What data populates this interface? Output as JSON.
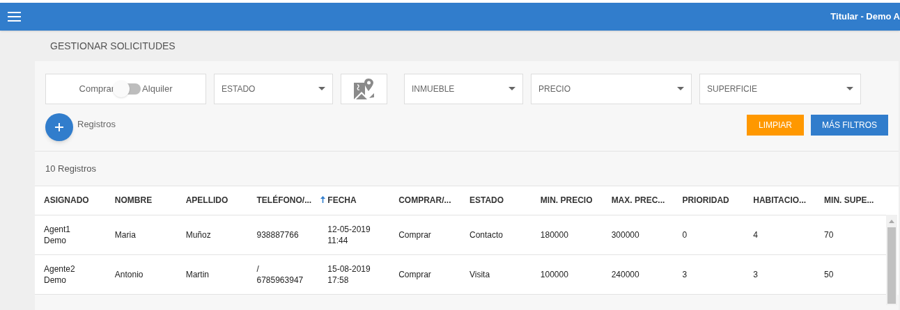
{
  "header": {
    "user": "Titular - Demo A"
  },
  "page_title": "GESTIONAR SOLICITUDES",
  "filters": {
    "toggle": {
      "left_label": "Comprar",
      "right_label": "Alquiler",
      "on": false
    },
    "selects": [
      {
        "kind": "select",
        "label": "ESTADO"
      },
      {
        "kind": "map"
      },
      {
        "kind": "select",
        "label": "INMUEBLE"
      },
      {
        "kind": "select",
        "label": "PRECIO"
      },
      {
        "kind": "select",
        "label": "SUPERFICIE"
      }
    ]
  },
  "add_label": "Registros",
  "buttons": [
    {
      "label": "LIMPIAR",
      "kind": "warning"
    },
    {
      "label": "MÁS FILTROS",
      "kind": "primary"
    }
  ],
  "count": "10 Registros",
  "table": {
    "columns": [
      {
        "label": "ASIGNADO",
        "sorted": false
      },
      {
        "label": "NOMBRE",
        "sorted": false
      },
      {
        "label": "APELLIDO",
        "sorted": false
      },
      {
        "label": "TELÉFONO/...",
        "sorted": false
      },
      {
        "label": "FECHA",
        "sorted": true
      },
      {
        "label": "COMPRAR/...",
        "sorted": false
      },
      {
        "label": "ESTADO",
        "sorted": false
      },
      {
        "label": "MIN. PRECIO",
        "sorted": false
      },
      {
        "label": "MAX. PREC...",
        "sorted": false
      },
      {
        "label": "PRIORIDAD",
        "sorted": false
      },
      {
        "label": "HABITACIO...",
        "sorted": false
      },
      {
        "label": "MIN. SUPE...",
        "sorted": false
      }
    ],
    "rows": [
      [
        "Agent1 Demo",
        "Maria",
        "Muñoz",
        "938887766",
        "12-05-2019 11:44",
        "Comprar",
        "Contacto",
        "180000",
        "300000",
        "0",
        "4",
        "70"
      ],
      [
        "Agente2 Demo",
        "Antonio",
        "Martin",
        "/ 6785963947",
        "15-08-2019 17:58",
        "Comprar",
        "Visita",
        "100000",
        "240000",
        "3",
        "3",
        "50"
      ]
    ]
  }
}
